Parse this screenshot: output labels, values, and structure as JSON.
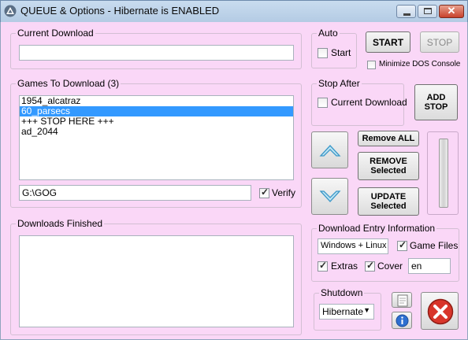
{
  "window": {
    "title": "QUEUE & Options - Hibernate is ENABLED"
  },
  "current_download": {
    "label": "Current Download",
    "value": ""
  },
  "auto": {
    "label": "Auto",
    "start_label": "Start",
    "start_checked": false
  },
  "controls": {
    "start_label": "START",
    "stop_label": "STOP",
    "minimize_label": "Minimize DOS Console",
    "minimize_checked": false,
    "add_stop_line1": "ADD",
    "add_stop_line2": "STOP"
  },
  "stop_after": {
    "label": "Stop After",
    "option_label": "Current Download",
    "checked": false
  },
  "games": {
    "label": "Games To Download  (3)",
    "items": [
      {
        "text": "1954_alcatraz",
        "selected": false
      },
      {
        "text": "60_parsecs",
        "selected": true
      },
      {
        "text": "+++ STOP HERE +++",
        "selected": false
      },
      {
        "text": "ad_2044",
        "selected": false
      }
    ],
    "path_value": "G:\\GOG",
    "verify_label": "Verify",
    "verify_checked": true
  },
  "queue_buttons": {
    "remove_all_label": "Remove ALL",
    "remove_line1": "REMOVE",
    "remove_line2": "Selected",
    "update_line1": "UPDATE",
    "update_line2": "Selected"
  },
  "finished": {
    "label": "Downloads Finished"
  },
  "entry_info": {
    "label": "Download Entry Information",
    "os_value": "Windows + Linux",
    "game_files_label": "Game Files",
    "game_files_checked": true,
    "extras_label": "Extras",
    "extras_checked": true,
    "cover_label": "Cover",
    "cover_checked": true,
    "lang_value": "en"
  },
  "shutdown": {
    "label": "Shutdown",
    "selected": "Hibernate"
  },
  "icons": {
    "app": "app-triangle-icon",
    "up": "arrow-up-icon",
    "down": "arrow-down-icon",
    "notes": "notepad-icon",
    "info": "info-icon",
    "exit": "red-x-close-icon"
  },
  "colors": {
    "background": "#fad7f7",
    "selection": "#3399ff"
  }
}
